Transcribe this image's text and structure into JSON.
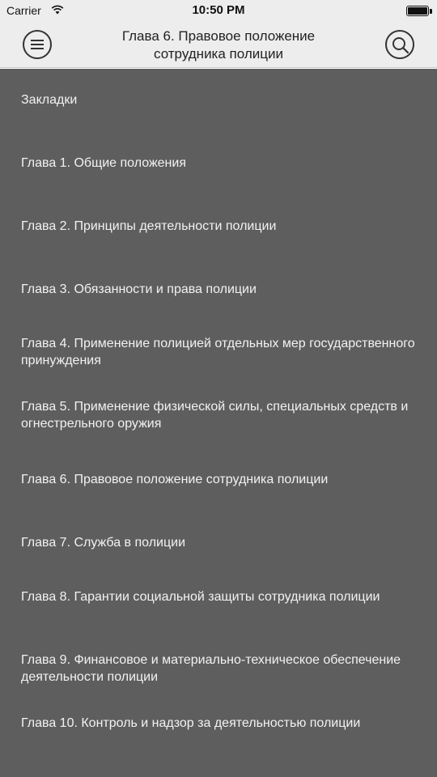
{
  "status_bar": {
    "carrier": "Carrier",
    "time": "10:50 PM",
    "wifi_icon": "wifi-icon",
    "battery_icon": "battery-icon"
  },
  "nav_bar": {
    "title": "Глава 6. Правовое положение сотрудника полиции",
    "menu_icon": "hamburger-menu-icon",
    "search_icon": "search-icon"
  },
  "drawer": {
    "background_color": "#5e5e5e",
    "items": [
      {
        "label": "Закладки"
      },
      {
        "label": "Глава 1. Общие положения"
      },
      {
        "label": "Глава 2. Принципы деятельности полиции"
      },
      {
        "label": "Глава 3. Обязанности и права полиции"
      },
      {
        "label": "Глава 4. Применение полицией отдельных мер государственного принуждения"
      },
      {
        "label": "Глава 5. Применение физической силы, специальных средств и огнестрельного оружия"
      },
      {
        "label": "Глава 6. Правовое положение сотрудника полиции"
      },
      {
        "label": "Глава 7. Служба в полиции"
      },
      {
        "label": "Глава 8. Гарантии социальной защиты сотрудника полиции"
      },
      {
        "label": "Глава 9. Финансовое и материально-техническое обеспечение деятельности полиции"
      },
      {
        "label": "Глава 10. Контроль и надзор за деятельностью полиции"
      }
    ]
  }
}
